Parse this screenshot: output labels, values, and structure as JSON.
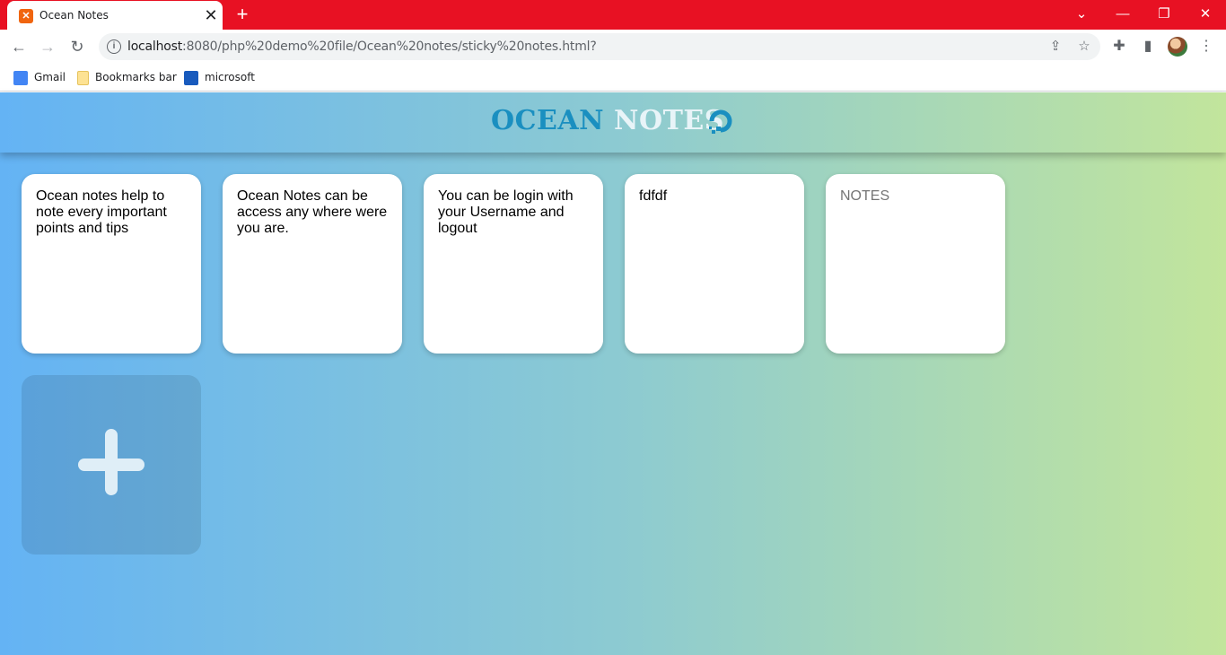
{
  "browser": {
    "tab_title": "Ocean Notes",
    "url_host": "localhost",
    "url_rest": ":8080/php%20demo%20file/Ocean%20notes/sticky%20notes.html?",
    "bookmarks": [
      "Gmail",
      "Bookmarks bar",
      "microsoft"
    ]
  },
  "app": {
    "brand_ocean": "OCEAN",
    "brand_notes": "NOTES"
  },
  "notes": [
    "Ocean notes help to note every important points and tips",
    "Ocean Notes can be access any where were you are.",
    "You can be login with your Username  and logout",
    "fdfdf"
  ],
  "note_placeholder": "NOTES",
  "colors": {
    "titlebar": "#e81123",
    "gradient_start": "#64b3f4",
    "gradient_end": "#c2e59c",
    "brand_accent": "#1a8fc0"
  }
}
